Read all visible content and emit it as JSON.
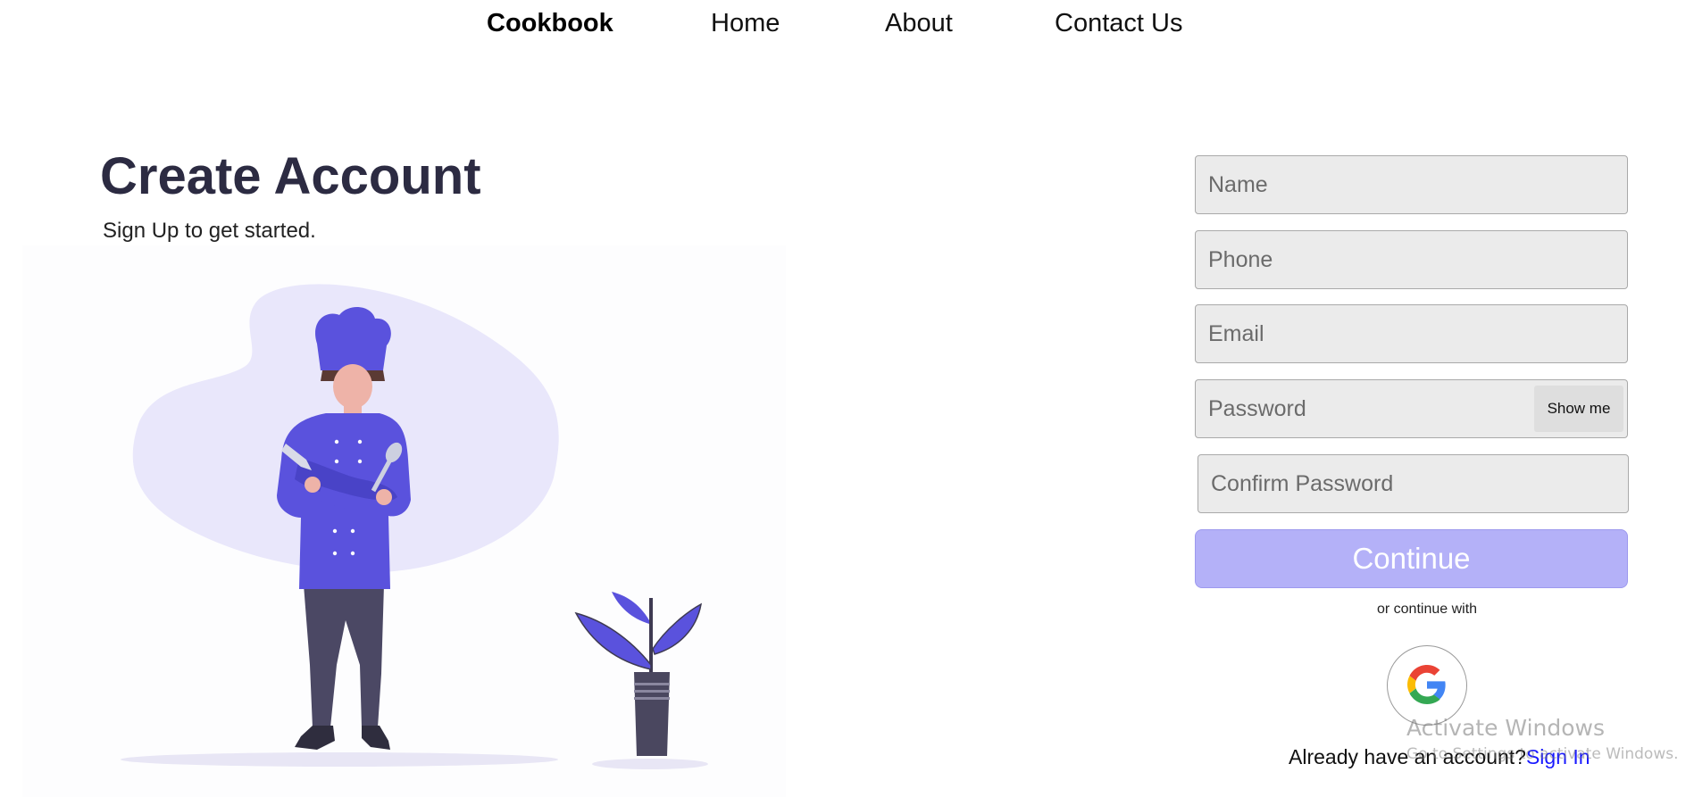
{
  "nav": {
    "brand": "Cookbook",
    "links": [
      "Home",
      "About",
      "Contact Us"
    ]
  },
  "hero": {
    "title": "Create Account",
    "subtitle": "Sign Up to get started."
  },
  "form": {
    "name_placeholder": "Name",
    "phone_placeholder": "Phone",
    "email_placeholder": "Email",
    "password_placeholder": "Password",
    "show_password_label": "Show me",
    "confirm_password_placeholder": "Confirm Password",
    "continue_label": "Continue",
    "or_continue_with": "or continue with",
    "google_icon": "google-icon",
    "have_account_text": "Already have an account?",
    "sign_in_label": "Sign In"
  },
  "watermark": {
    "title": "Activate Windows",
    "subtitle": "Go to Settings to activate Windows."
  },
  "colors": {
    "heading": "#2c2b42",
    "accent": "#5a52dd",
    "continue_bg": "#b4b1f8",
    "link": "#1a1aff",
    "field_bg": "#ebebeb"
  }
}
